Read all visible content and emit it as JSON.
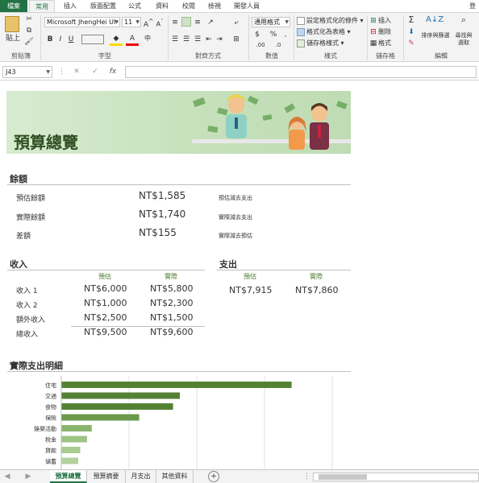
{
  "ribbon_tabs": [
    "檔案",
    "常用",
    "插入",
    "版面配置",
    "公式",
    "資料",
    "校閱",
    "檢視",
    "開發人員"
  ],
  "account_hint": "登",
  "clipboard": {
    "paste": "貼上",
    "label": "剪貼簿"
  },
  "font": {
    "name": "Microsoft JhengHei UI",
    "size": "11",
    "label": "字型"
  },
  "alignment": {
    "label": "對齊方式"
  },
  "number": {
    "format": "通用格式",
    "label": "數值"
  },
  "styles": {
    "conditional": "設定格式化的條件 ▾",
    "as_table": "格式化為表格 ▾",
    "cell_styles": "儲存格樣式 ▾",
    "label": "樣式"
  },
  "cells": {
    "insert": "插入",
    "delete": "刪除",
    "format": "格式",
    "label": "儲存格"
  },
  "editing": {
    "sort": "排序與篩選",
    "find": "尋找與選取",
    "label": "編輯"
  },
  "name_box": "J43",
  "banner_title": "預算總覽",
  "balance": {
    "title": "餘額",
    "rows": [
      {
        "label": "預估餘額",
        "value": "NT$1,585",
        "note": "預估減去支出"
      },
      {
        "label": "實際餘額",
        "value": "NT$1,740",
        "note": "實際減去支出"
      },
      {
        "label": "差額",
        "value": "NT$155",
        "note": "實際減去預估"
      }
    ]
  },
  "income": {
    "title": "收入",
    "col_est": "預估",
    "col_act": "實際",
    "rows": [
      {
        "label": "收入 1",
        "est": "NT$6,000",
        "act": "NT$5,800"
      },
      {
        "label": "收入 2",
        "est": "NT$1,000",
        "act": "NT$2,300"
      },
      {
        "label": "額外收入",
        "est": "NT$2,500",
        "act": "NT$1,500"
      },
      {
        "label": "總收入",
        "est": "NT$9,500",
        "act": "NT$9,600"
      }
    ]
  },
  "expense": {
    "title": "支出",
    "col_est": "預估",
    "col_act": "實際",
    "est": "NT$7,915",
    "act": "NT$7,860"
  },
  "chart_title": "實際支出明細",
  "chart_data": {
    "type": "bar",
    "orientation": "horizontal",
    "categories": [
      "住宅",
      "交通",
      "食物",
      "保險",
      "娛樂活動",
      "稅金",
      "貸款",
      "儲蓄"
    ],
    "values": [
      3400,
      1750,
      1650,
      1150,
      450,
      380,
      280,
      250
    ],
    "xlim": [
      0,
      4000
    ],
    "grid": true,
    "colors": [
      "#548235",
      "#548235",
      "#548235",
      "#6a9a4a",
      "#8ab56e",
      "#9cc483",
      "#a8cb90",
      "#b2d19c"
    ]
  },
  "sheet_tabs": [
    "預算總覽",
    "預算摘要",
    "月支出",
    "其他資料"
  ],
  "active_sheet": 0
}
